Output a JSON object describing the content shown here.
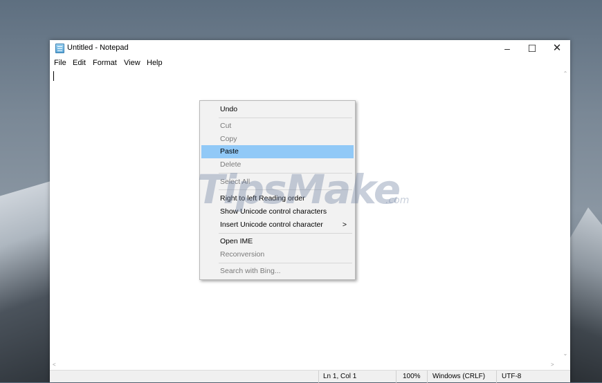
{
  "window": {
    "title": "Untitled - Notepad",
    "controls": {
      "minimize": "–",
      "maximize": "☐",
      "close": "✕"
    }
  },
  "menubar": [
    "File",
    "Edit",
    "Format",
    "View",
    "Help"
  ],
  "scroll": {
    "up": "⌃",
    "down": "⌄",
    "left": "<",
    "right": ">"
  },
  "status": {
    "position": "Ln 1, Col 1",
    "zoom": "100%",
    "line_ending": "Windows (CRLF)",
    "encoding": "UTF-8"
  },
  "context_menu": {
    "items": [
      {
        "label": "Undo",
        "enabled": true
      },
      {
        "label": "Cut",
        "enabled": false
      },
      {
        "label": "Copy",
        "enabled": false
      },
      {
        "label": "Paste",
        "enabled": true,
        "highlighted": true
      },
      {
        "label": "Delete",
        "enabled": false
      },
      {
        "label": "Select All",
        "enabled": false
      },
      {
        "label": "Right to left Reading order",
        "enabled": true
      },
      {
        "label": "Show Unicode control characters",
        "enabled": true
      },
      {
        "label": "Insert Unicode control character",
        "enabled": true,
        "submenu_arrow": ">"
      },
      {
        "label": "Open IME",
        "enabled": true
      },
      {
        "label": "Reconversion",
        "enabled": false
      },
      {
        "label": "Search with Bing...",
        "enabled": false
      }
    ],
    "highlight_color": "#91c9f7"
  },
  "watermark": {
    "main": "TipsMake",
    "suffix": ".com"
  }
}
